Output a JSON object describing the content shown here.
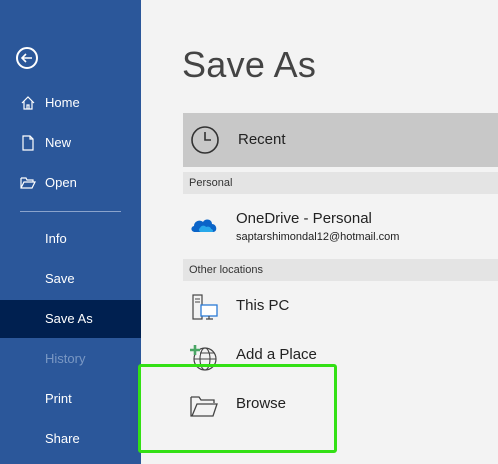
{
  "sidebar": {
    "back_icon": "back-arrow-icon",
    "items": [
      {
        "label": "Home",
        "icon": "home-icon"
      },
      {
        "label": "New",
        "icon": "new-document-icon"
      },
      {
        "label": "Open",
        "icon": "open-folder-icon"
      },
      {
        "label": "Info"
      },
      {
        "label": "Save"
      },
      {
        "label": "Save As",
        "active": true
      },
      {
        "label": "History",
        "disabled": true
      },
      {
        "label": "Print"
      },
      {
        "label": "Share"
      }
    ]
  },
  "main": {
    "title": "Save As",
    "recent": {
      "label": "Recent",
      "icon": "clock-icon"
    },
    "sections": [
      {
        "header": "Personal"
      },
      {
        "header": "Other locations"
      }
    ],
    "onedrive": {
      "label": "OneDrive - Personal",
      "email": "saptarshimondal12@hotmail.com",
      "icon": "onedrive-cloud-icon"
    },
    "this_pc": {
      "label": "This PC",
      "icon": "computer-icon"
    },
    "add_place": {
      "label": "Add a Place",
      "icon": "globe-plus-icon"
    },
    "browse": {
      "label": "Browse",
      "icon": "folder-icon"
    }
  },
  "colors": {
    "sidebar": "#2b579a",
    "sidebar_active": "#002050",
    "highlight": "#33e014",
    "onedrive": "#0a64c8"
  }
}
